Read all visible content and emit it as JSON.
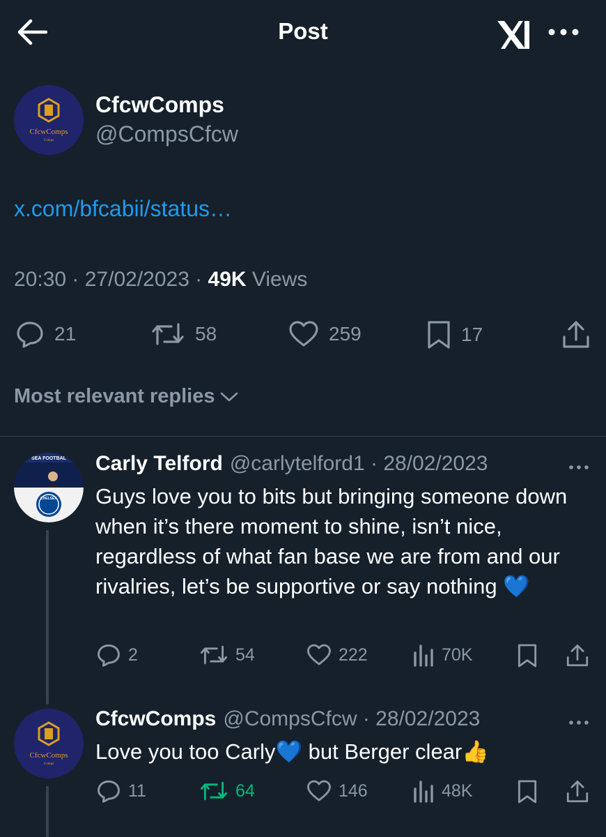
{
  "header": {
    "title": "Post"
  },
  "post": {
    "author_name": "CfcwComps",
    "author_handle": "@CompsCfcw",
    "avatar_text": "CfcwComps",
    "avatar_subtext": "Comps",
    "link": "x.com/bfcabii/status…",
    "time": "20:30 · 27/02/2023 · ",
    "views_count": "49K",
    "views_label": " Views",
    "replies": "21",
    "reposts": "58",
    "likes": "259",
    "bookmarks": "17"
  },
  "sort": {
    "label": "Most relevant replies"
  },
  "replies": [
    {
      "name": "Carly Telford",
      "handle_date": "@carlytelford1 · 28/02/2023",
      "avatar_banner": "SEA FOOTBAL",
      "avatar_crest": "CHELSEA",
      "text": "Guys love you to bits but bringing someone down when it’s there moment to shine, isn’t nice, regardless of what fan base we are from and our rivalries, let’s be supportive or say nothing 💙",
      "replies": "2",
      "reposts": "54",
      "likes": "222",
      "views": "70K"
    },
    {
      "name": "CfcwComps",
      "handle_date": "@CompsCfcw · 28/02/2023",
      "avatar_text": "CfcwComps",
      "avatar_subtext": "Comps",
      "text": "Love you too Carly💙 but Berger clear👍",
      "replies": "11",
      "reposts": "64",
      "likes": "146",
      "views": "48K"
    }
  ],
  "colors": {
    "background": "#15202b",
    "muted": "#8b98a5",
    "link": "#1d9bf0",
    "repost_active": "#00ba7c",
    "avatar_bg": "#20246b",
    "avatar_gold": "#d9a021"
  }
}
